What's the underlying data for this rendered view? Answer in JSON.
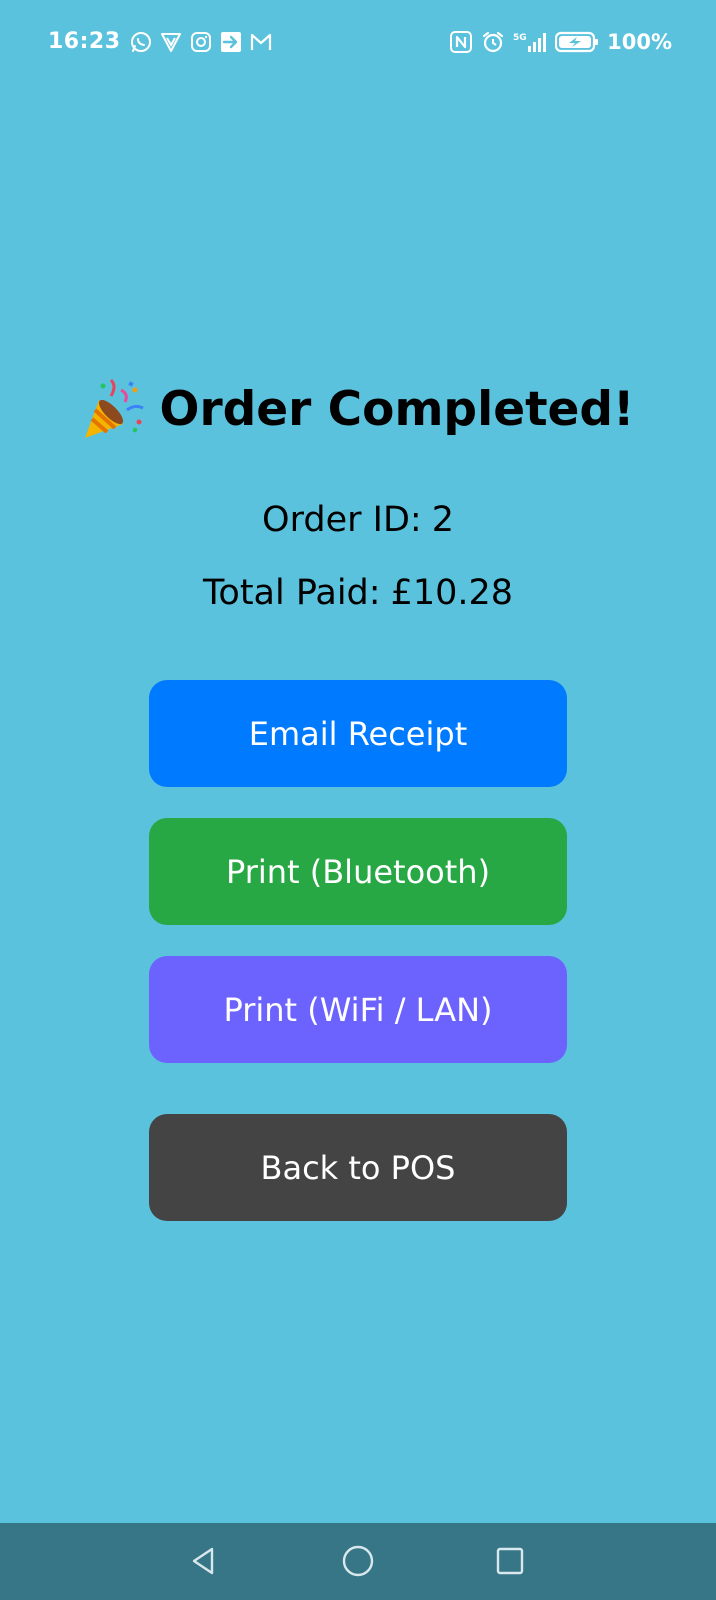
{
  "status_bar": {
    "time": "16:23",
    "battery_text": "100%",
    "left_icons": [
      "whatsapp-icon",
      "vpn-shield-icon",
      "instagram-icon",
      "forward-arrow-icon",
      "gmail-icon"
    ],
    "right_icons": [
      "nfc-icon",
      "alarm-icon",
      "signal-5g-icon",
      "battery-charging-icon"
    ],
    "network_label": "5G"
  },
  "main": {
    "title_icon": "party-popper-icon",
    "title": "Order Completed!",
    "order_id_label": "Order ID:",
    "order_id_value": "2",
    "total_paid_label": "Total Paid:",
    "total_paid_value": "£10.28"
  },
  "buttons": {
    "email_receipt": "Email Receipt",
    "print_bluetooth": "Print (Bluetooth)",
    "print_wifi": "Print (WiFi / LAN)",
    "back_to_pos": "Back to POS"
  },
  "nav_bar": {
    "icons": [
      "back-triangle-icon",
      "home-circle-icon",
      "recents-square-icon"
    ]
  },
  "colors": {
    "background": "#5bc2dd",
    "email_button": "#007bff",
    "bluetooth_button": "#28a745",
    "wifi_button": "#6c63ff",
    "back_button": "#444444",
    "nav_bar": "#367686"
  }
}
